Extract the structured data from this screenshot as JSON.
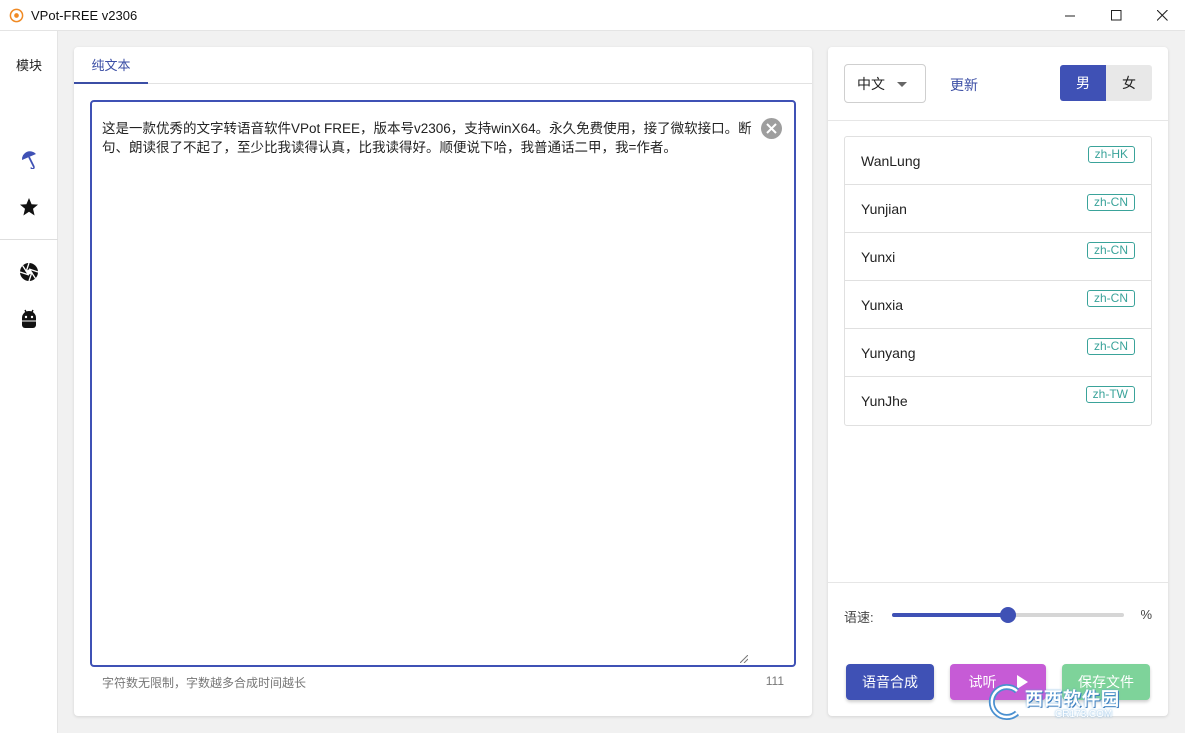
{
  "window": {
    "title": "VPot-FREE v2306"
  },
  "nav": {
    "module_label": "模块",
    "icons": [
      "umbrella-icon",
      "star-icon",
      "aperture-icon",
      "robot-icon"
    ]
  },
  "editor": {
    "tab_label": "纯文本",
    "text": "这是一款优秀的文字转语音软件VPot FREE，版本号v2306，支持winX64。永久免费使用，接了微软接口。断句、朗读很了不起了，至少比我读得认真，比我读得好。顺便说下哈，我普通话二甲，我=作者。",
    "hint": "字符数无限制，字数越多合成时间越长",
    "char_count": "111"
  },
  "voice_panel": {
    "language": "中文",
    "update_label": "更新",
    "gender_male": "男",
    "gender_female": "女",
    "voices": [
      {
        "name": "WanLung",
        "locale": "zh-HK"
      },
      {
        "name": "Yunjian",
        "locale": "zh-CN"
      },
      {
        "name": "Yunxi",
        "locale": "zh-CN"
      },
      {
        "name": "Yunxia",
        "locale": "zh-CN"
      },
      {
        "name": "Yunyang",
        "locale": "zh-CN"
      },
      {
        "name": "YunJhe",
        "locale": "zh-TW"
      }
    ],
    "speed_label": "语速:",
    "speed_unit": "%",
    "speed_fraction": 0.5
  },
  "actions": {
    "synthesize": "语音合成",
    "listen": "试听",
    "save": "保存文件"
  },
  "watermark": {
    "main": "西西软件园",
    "sub": "CR173.COM"
  },
  "colors": {
    "accent": "#3f51b5",
    "listen": "#c65bd6",
    "save": "#7ed39a",
    "tag": "#3aa39a"
  }
}
